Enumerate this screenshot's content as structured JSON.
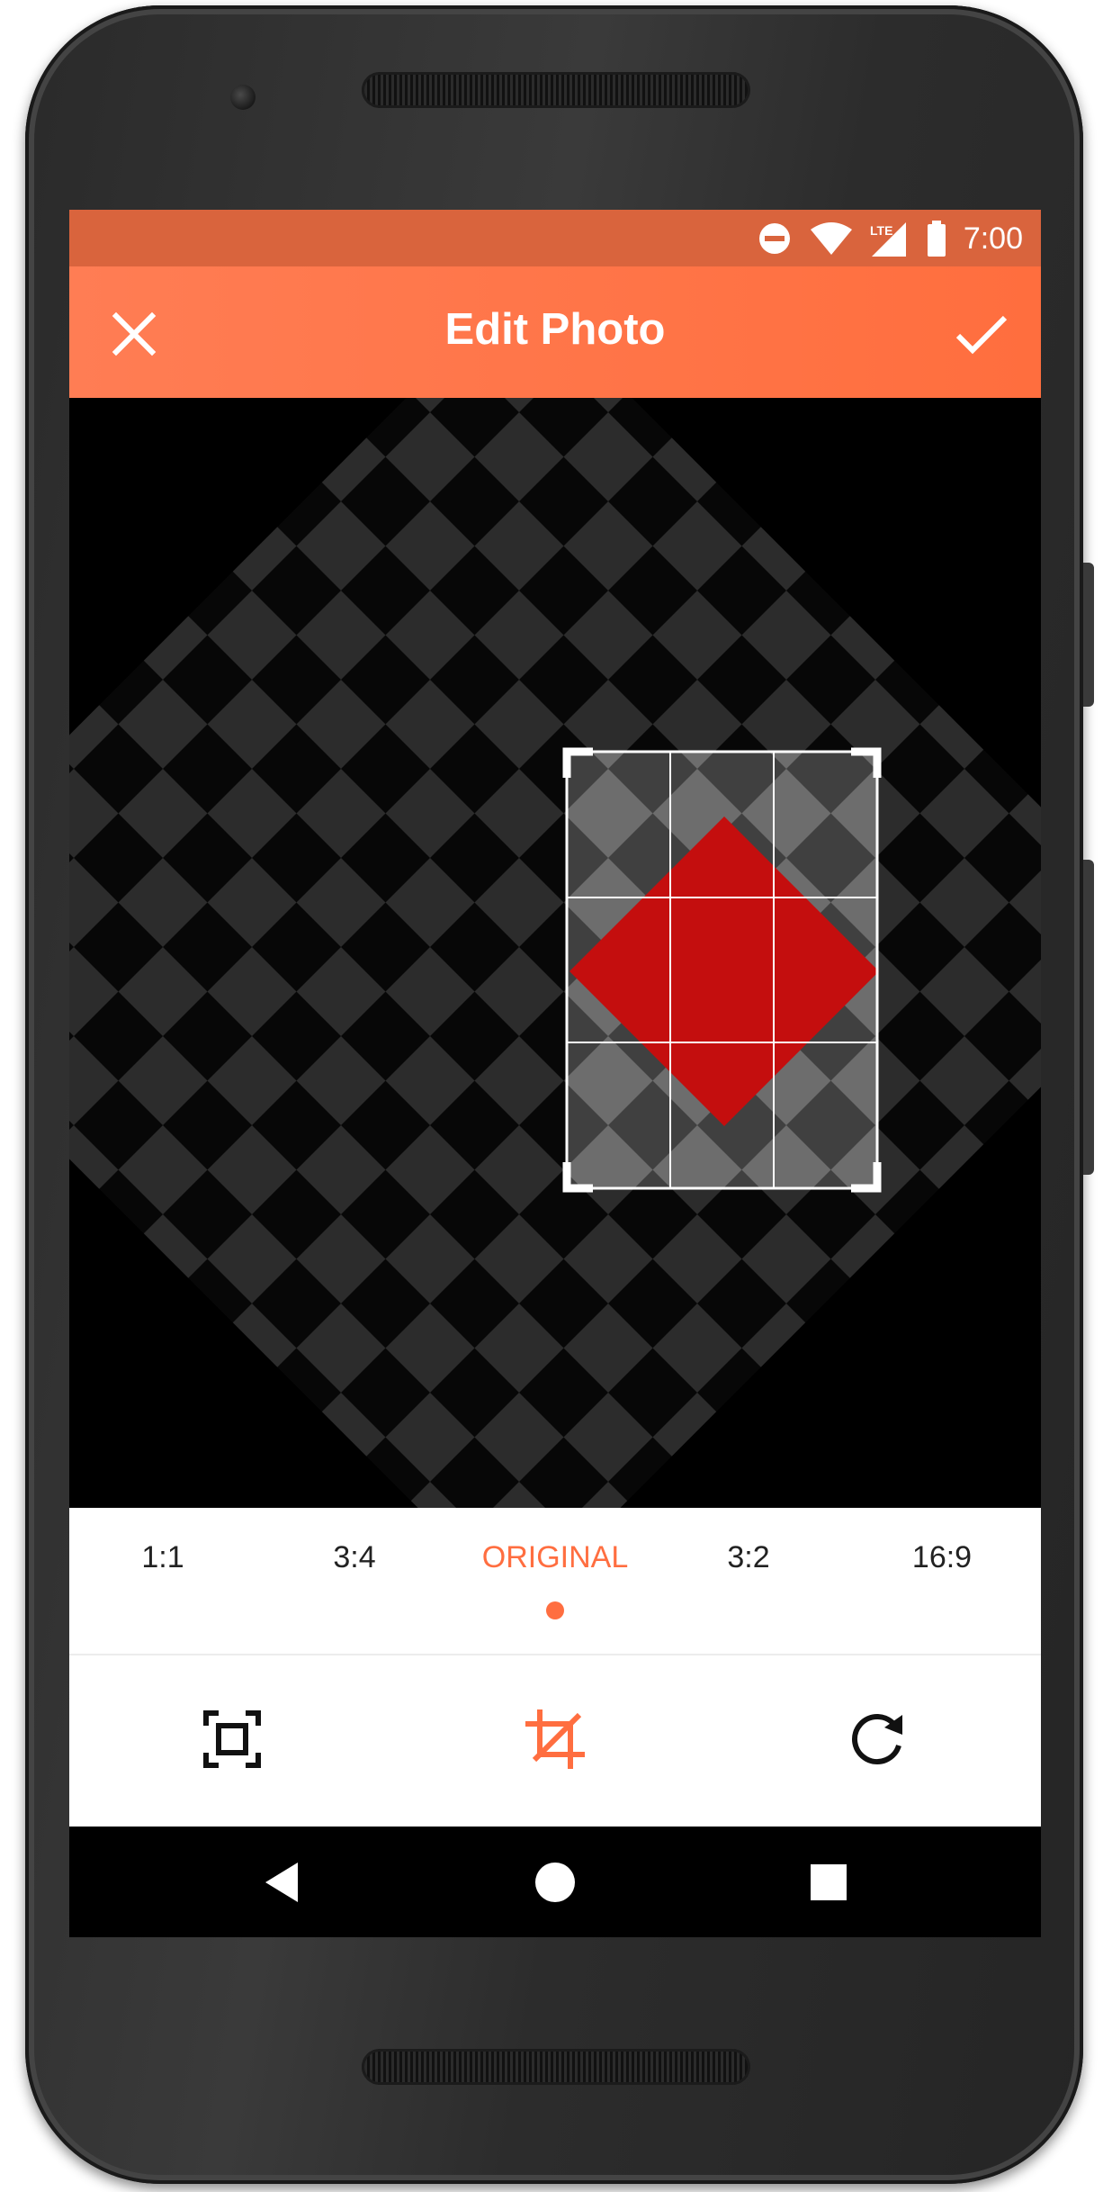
{
  "status_bar": {
    "time": "7:00",
    "network_badge": "LTE"
  },
  "app_bar": {
    "title": "Edit Photo"
  },
  "aspect_ratios": {
    "options": [
      "1:1",
      "3:4",
      "ORIGINAL",
      "3:2",
      "16:9"
    ],
    "selected": "ORIGINAL"
  },
  "toolbar": {
    "tools": [
      "fit-screen-icon",
      "crop-icon",
      "rotate-icon"
    ],
    "active_tool": "crop-icon"
  },
  "nav_bar": {
    "buttons": [
      "back-icon",
      "home-icon",
      "recents-icon"
    ]
  },
  "colors": {
    "accent": "#ff6e40",
    "status_bar": "#d9643d",
    "diamond": "#c40e0e",
    "checker_light": "#444444"
  }
}
